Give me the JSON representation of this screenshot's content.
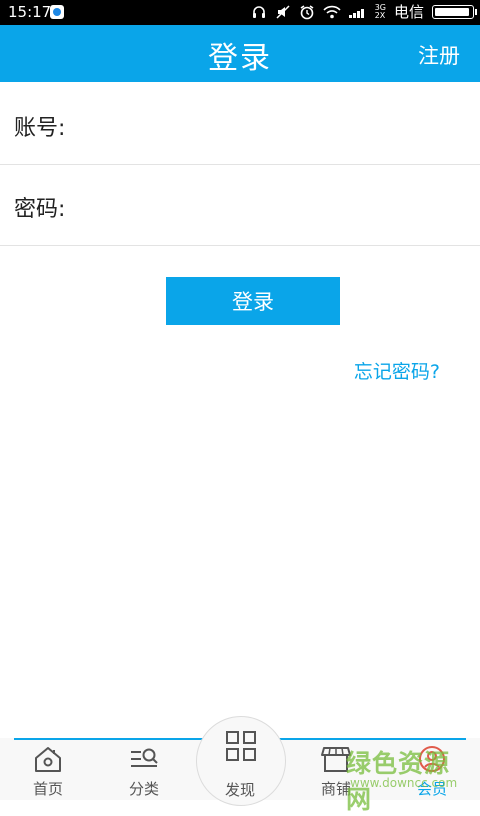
{
  "status_bar": {
    "time": "15:17",
    "signal_label_top": "3G",
    "signal_label_bottom": "2X",
    "carrier": "电信"
  },
  "header": {
    "title": "登录",
    "register_label": "注册"
  },
  "form": {
    "account_label": "账号:",
    "account_value": "",
    "password_label": "密码:",
    "password_value": ""
  },
  "login_button_label": "登录",
  "forgot_password_label": "忘记密码?",
  "nav": {
    "items": [
      {
        "label": "首页",
        "icon": "home-icon"
      },
      {
        "label": "分类",
        "icon": "category-icon"
      },
      {
        "label": "发现",
        "icon": "discover-grid-icon"
      },
      {
        "label": "商铺",
        "icon": "shop-icon"
      },
      {
        "label": "会员",
        "icon": "member-icon"
      }
    ],
    "active_index": 4
  },
  "watermark": {
    "text": "绿色资源网",
    "url": "www.downcc.com"
  },
  "colors": {
    "accent": "#0aa5e9",
    "status_bar": "#000000",
    "background": "#ffffff"
  }
}
